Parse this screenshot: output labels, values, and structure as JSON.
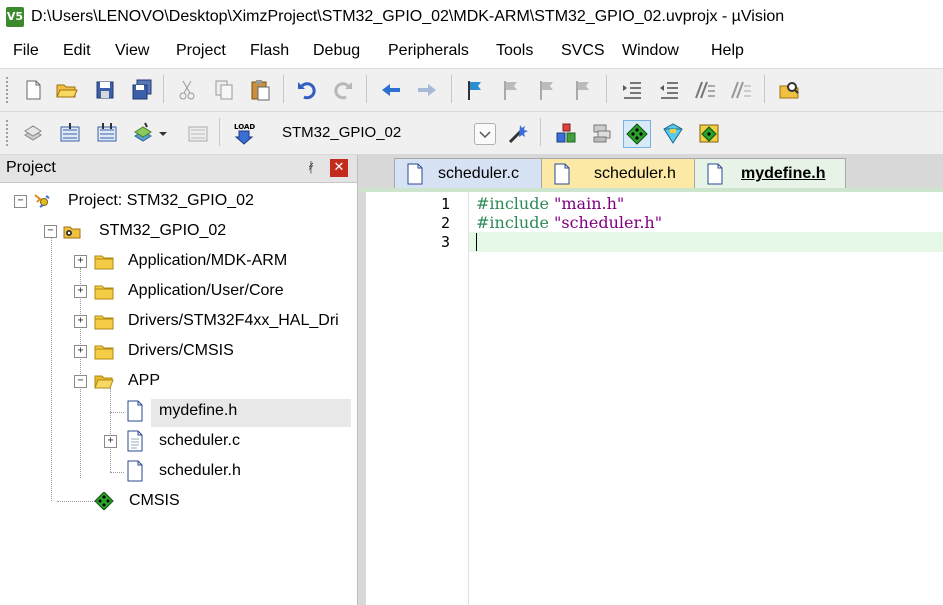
{
  "window": {
    "title": "D:\\Users\\LENOVO\\Desktop\\XimzProject\\STM32_GPIO_02\\MDK-ARM\\STM32_GPIO_02.uvprojx - µVision",
    "app_icon": "V5"
  },
  "menu": {
    "items": [
      "File",
      "Edit",
      "View",
      "Project",
      "Flash",
      "Debug",
      "Peripherals",
      "Tools",
      "SVCS",
      "Window",
      "Help"
    ]
  },
  "toolbar": {
    "target": "STM32_GPIO_02"
  },
  "project_panel": {
    "title": "Project",
    "tree": {
      "root": "Project: STM32_GPIO_02",
      "target": "STM32_GPIO_02",
      "groups": [
        "Application/MDK-ARM",
        "Application/User/Core",
        "Drivers/STM32F4xx_HAL_Dri",
        "Drivers/CMSIS",
        "APP"
      ],
      "app_files": [
        "mydefine.h",
        "scheduler.c",
        "scheduler.h"
      ],
      "cmsis": "CMSIS"
    }
  },
  "editor": {
    "tabs": [
      "scheduler.c",
      "scheduler.h",
      "mydefine.h"
    ],
    "active_tab": "mydefine.h",
    "line_numbers": [
      "1",
      "2",
      "3"
    ],
    "lines": [
      {
        "directive": "#include",
        "file": "\"main.h\""
      },
      {
        "directive": "#include",
        "file": "\"scheduler.h\""
      }
    ]
  },
  "colors": {
    "keyword": "#2e8b57",
    "string": "#800080",
    "current_line": "#e6f9e6"
  }
}
